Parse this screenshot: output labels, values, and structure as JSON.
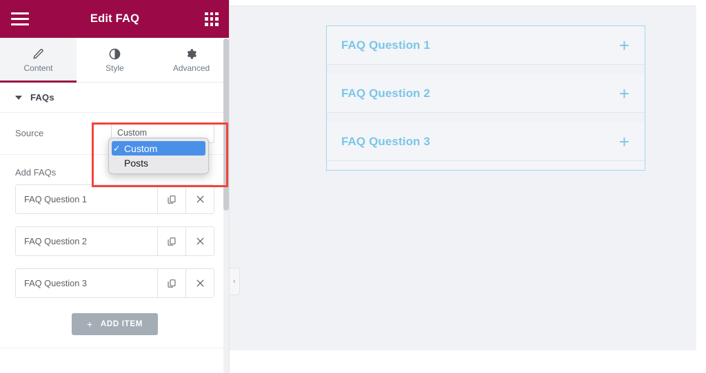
{
  "panel": {
    "header": {
      "title": "Edit FAQ",
      "menu_icon": "hamburger-icon",
      "apps_icon": "grid-apps-icon"
    },
    "tabs": [
      {
        "label": "Content",
        "icon": "pencil-icon",
        "active": true
      },
      {
        "label": "Style",
        "icon": "half-circle-contrast-icon",
        "active": false
      },
      {
        "label": "Advanced",
        "icon": "gear-icon",
        "active": false
      }
    ],
    "section": {
      "title": "FAQs",
      "toggle_icon": "caret-down-icon"
    },
    "source": {
      "label": "Source",
      "value": "Custom",
      "options": [
        "Custom",
        "Posts"
      ],
      "selected_index": 0,
      "check_glyph": "✓"
    },
    "add_faqs_label": "Add FAQs",
    "faq_items": [
      {
        "title": "FAQ Question 1",
        "duplicate_icon": "copy-icon",
        "remove_icon": "close-icon"
      },
      {
        "title": "FAQ Question 2",
        "duplicate_icon": "copy-icon",
        "remove_icon": "close-icon"
      },
      {
        "title": "FAQ Question 3",
        "duplicate_icon": "copy-icon",
        "remove_icon": "close-icon"
      }
    ],
    "add_item_button": {
      "label": "ADD ITEM",
      "plus": "+"
    }
  },
  "canvas": {
    "collapse_handle": "‹",
    "preview_items": [
      {
        "question": "FAQ Question 1",
        "toggle": "+"
      },
      {
        "question": "FAQ Question 2",
        "toggle": "+"
      },
      {
        "question": "FAQ Question 3",
        "toggle": "+"
      }
    ]
  },
  "annotation": {
    "type": "red-highlight-rectangle",
    "target": "source-select-dropdown"
  },
  "colors": {
    "header_bg": "#9b0a46",
    "accent": "#9b0a46",
    "dropdown_selected": "#4a90e8",
    "preview_text": "#79c6e8",
    "annotation": "#f4433a",
    "add_button": "#a4adb6"
  }
}
